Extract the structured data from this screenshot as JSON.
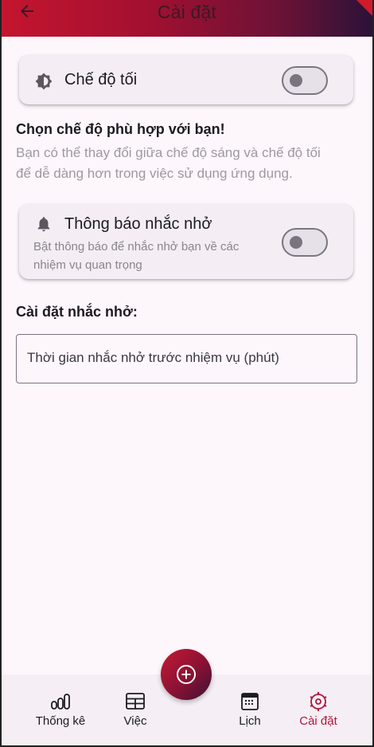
{
  "appbar": {
    "title": "Cài đặt",
    "back_icon": "arrow-left-icon"
  },
  "dark_mode": {
    "label": "Chế độ tối",
    "icon": "brightness-icon",
    "enabled": false
  },
  "mode_section": {
    "heading": "Chọn chế độ phù hợp với bạn!",
    "description_line1": "Bạn có thể thay đổi giữa chế độ sáng và chế độ tối",
    "description_line2": "để dễ dàng hơn trong việc sử dụng ứng dụng."
  },
  "notifications": {
    "label": "Thông báo nhắc nhở",
    "icon": "bell-icon",
    "subtitle_line1": "Bật thông báo để nhắc nhở bạn về các",
    "subtitle_line2": "nhiệm vụ quan trọng",
    "enabled": false
  },
  "reminder_settings": {
    "heading": "Cài đặt nhắc nhở:",
    "input_placeholder": "Thời gian nhắc nhở trước nhiệm vụ (phút)",
    "input_value": ""
  },
  "bottom_nav": {
    "items": [
      {
        "label": "Thống kê",
        "icon": "bar-chart-icon",
        "active": false
      },
      {
        "label": "Việc",
        "icon": "table-icon",
        "active": false
      },
      {
        "label": "Lịch",
        "icon": "calendar-icon",
        "active": false
      },
      {
        "label": "Cài đặt",
        "icon": "settings-icon",
        "active": true
      }
    ],
    "fab_icon": "add-circle-icon"
  },
  "colors": {
    "accent": "#b0163a",
    "background": "#fdf6fb",
    "card": "#f4eef4"
  }
}
